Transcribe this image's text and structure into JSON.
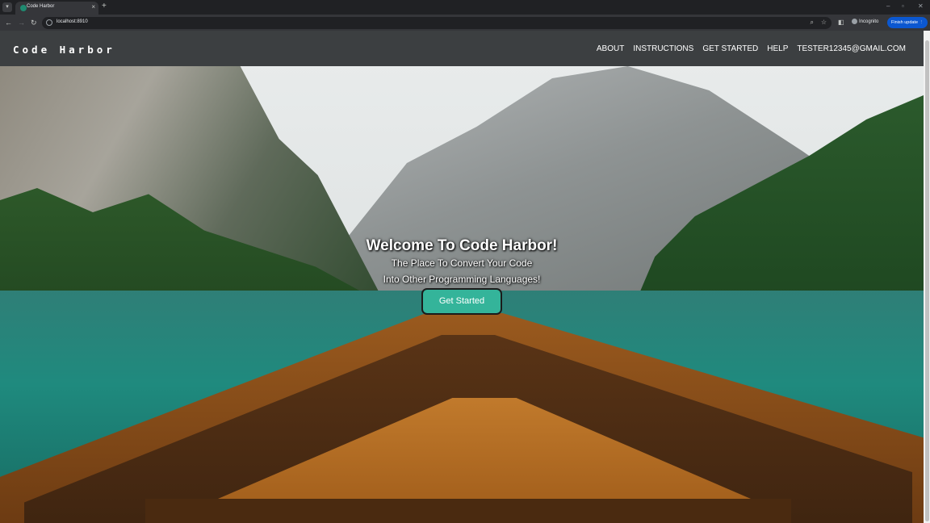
{
  "browser": {
    "tab_title": "Code Harbor",
    "url": "localhost:8910",
    "incognito_label": "Incognito",
    "finish_update_label": "Finish update"
  },
  "site": {
    "brand": "Code Harbor",
    "nav": [
      "ABOUT",
      "INSTRUCTIONS",
      "GET STARTED",
      "HELP",
      "TESTER12345@GMAIL.COM"
    ]
  },
  "hero": {
    "title": "Welcome To Code Harbor!",
    "subtitle_line1": "The Place To Convert Your Code",
    "subtitle_line2": "Into Other Programming Languages!",
    "cta_label": "Get Started"
  }
}
